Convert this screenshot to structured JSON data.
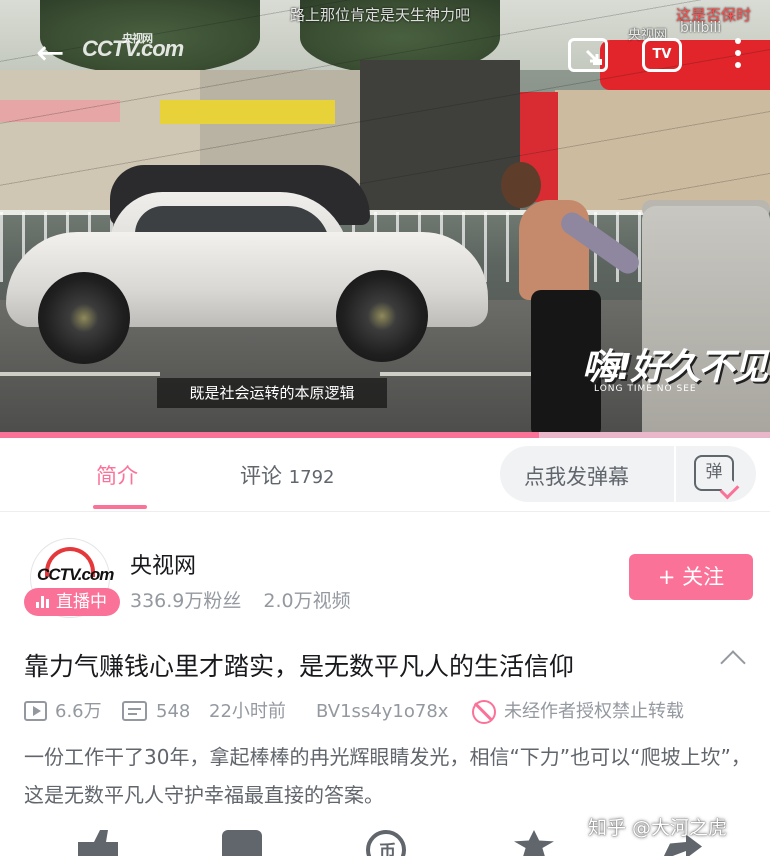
{
  "video": {
    "overlay_lines": [
      "路上那位肯定是天生神力吧",
      "这是否保时",
      "央视网",
      "bilibili"
    ],
    "subtitle": "既是社会运转的本原逻辑",
    "brand_mark": "嗨!好久不见",
    "brand_sub": "LONG TIME NO SEE",
    "logo_text": "CCTV.com",
    "logo_small": "央视网",
    "progress_fraction": 0.7,
    "tv_label": "TV"
  },
  "tabs": [
    {
      "label": "简介"
    },
    {
      "label": "评论",
      "count": "1792"
    }
  ],
  "danmaku": {
    "placeholder": "点我发弹幕",
    "icon_text": "弹"
  },
  "uploader": {
    "avatar_logo": "CCTV.com",
    "live_badge": "直播中",
    "name": "央视网",
    "fans": "336.9万粉丝",
    "videos": "2.0万视频",
    "follow_label": "+ 关注"
  },
  "video_info": {
    "title": "靠力气赚钱心里才踏实，是无数平凡人的生活信仰",
    "views": "6.6万",
    "danmaku_count": "548",
    "time": "22小时前",
    "bvid": "BV1ss4y1o78x",
    "copyright": "未经作者授权禁止转载",
    "description": "一份工作干了30年，拿起棒棒的冉光辉眼睛发光，相信“下力”也可以“爬坡上坎”，这是无数平凡人守护幸福最直接的答案。"
  },
  "actions": {
    "coin_icon_text": "币"
  },
  "watermark": "知乎 @大河之虎",
  "colors": {
    "accent": "#fb7299",
    "text_primary": "#18191c",
    "text_secondary": "#61666d",
    "text_muted": "#9499a0"
  },
  "icons": [
    "back-arrow-icon",
    "cast-icon",
    "tv-icon",
    "more-icon",
    "play-count-icon",
    "danmaku-count-icon",
    "no-repost-icon",
    "chevron-up-icon",
    "like-icon",
    "bookmark-icon",
    "coin-icon",
    "favorite-icon",
    "share-icon"
  ]
}
